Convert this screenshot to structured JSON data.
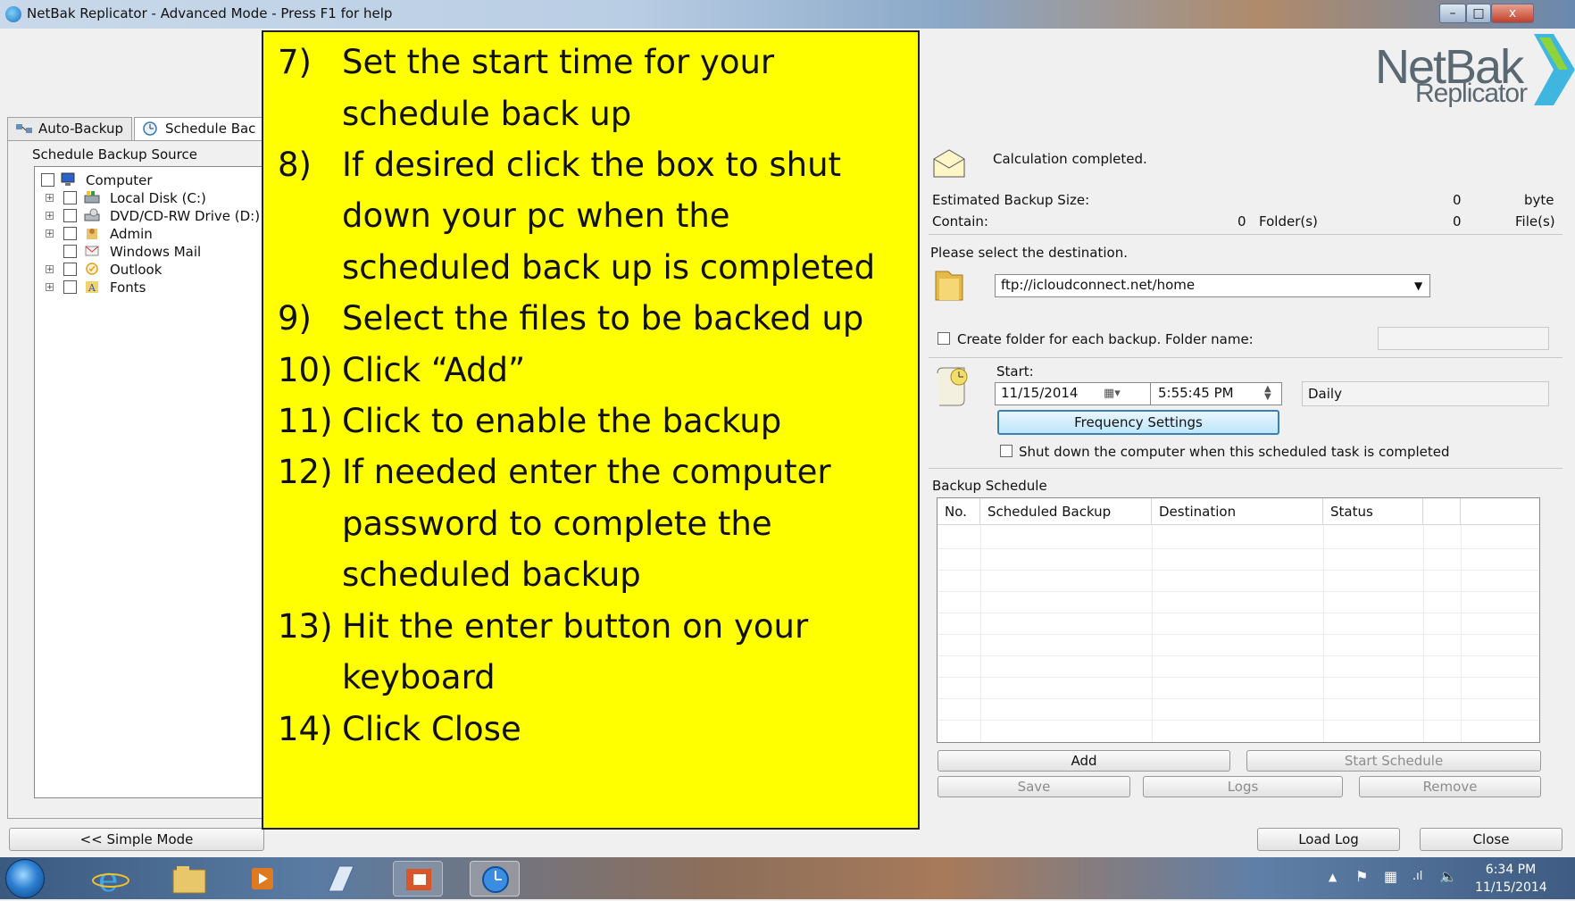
{
  "window": {
    "title": "NetBak Replicator - Advanced Mode - Press F1 for help",
    "controls": {
      "minimize": "–",
      "maximize": "□",
      "close": "x"
    }
  },
  "logo": {
    "line1": "NetBak",
    "line2": "Replicator"
  },
  "tabs": [
    {
      "label": "Auto-Backup",
      "icon": "network-icon"
    },
    {
      "label": "Schedule Bac",
      "icon": "clock-icon"
    }
  ],
  "source_panel": {
    "label": "Schedule Backup Source",
    "tree": [
      {
        "label": "Computer",
        "icon": "computer-icon"
      },
      {
        "label": "Local Disk (C:)",
        "icon": "disk-icon"
      },
      {
        "label": "DVD/CD-RW Drive (D:)",
        "icon": "dvd-icon"
      },
      {
        "label": "Admin",
        "icon": "user-folder-icon"
      },
      {
        "label": "Windows Mail",
        "icon": "mail-icon"
      },
      {
        "label": "Outlook",
        "icon": "outlook-icon"
      },
      {
        "label": "Fonts",
        "icon": "fonts-icon"
      }
    ]
  },
  "status": {
    "message": "Calculation completed."
  },
  "estimate": {
    "size_label": "Estimated Backup Size:",
    "size_value": "0",
    "size_unit": "byte",
    "contain_label": "Contain:",
    "folders_value": "0",
    "folders_unit": "Folder(s)",
    "files_value": "0",
    "files_unit": "File(s)"
  },
  "destination": {
    "prompt": "Please select the destination.",
    "value": "ftp://icloudconnect.net/home"
  },
  "create_folder": {
    "label": "Create folder for each backup. Folder name:",
    "value": ""
  },
  "start": {
    "label": "Start:",
    "date": "11/15/2014",
    "time": "5:55:45 PM",
    "frequency": "Daily",
    "frequency_button": "Frequency Settings",
    "shutdown_label": "Shut down the computer when this scheduled task is completed"
  },
  "schedule": {
    "label": "Backup Schedule",
    "columns": [
      "No.",
      "Scheduled Backup",
      "Destination",
      "Status"
    ],
    "rows": []
  },
  "actions": {
    "add": "Add",
    "start_schedule": "Start Schedule",
    "save": "Save",
    "logs": "Logs",
    "remove": "Remove"
  },
  "footer": {
    "simple_mode": "<< Simple Mode",
    "load_log": "Load Log",
    "close": "Close"
  },
  "taskbar": {
    "apps": [
      "internet-explorer-icon",
      "file-explorer-icon",
      "media-player-icon",
      "notepad-icon",
      "outlook-icon",
      "netbak-icon"
    ],
    "time": "6:34 PM",
    "date": "11/15/2014"
  },
  "instructions": [
    {
      "num": "7)",
      "lines": [
        "Set the start time for your",
        "schedule back up"
      ]
    },
    {
      "num": "8)",
      "lines": [
        "If desired click the box to shut",
        "down your pc when the",
        "scheduled back up is completed"
      ]
    },
    {
      "num": "9)",
      "lines": [
        "Select the files to be backed up"
      ]
    },
    {
      "num": "10)",
      "lines": [
        "Click “Add”"
      ]
    },
    {
      "num": "11)",
      "lines": [
        "Click to enable the backup"
      ]
    },
    {
      "num": "12)",
      "lines": [
        "If needed enter the computer",
        "password to complete the",
        "scheduled backup"
      ]
    },
    {
      "num": "13)",
      "lines": [
        "Hit the enter button on your",
        "keyboard"
      ]
    },
    {
      "num": "14)",
      "lines": [
        "Click Close"
      ]
    }
  ]
}
